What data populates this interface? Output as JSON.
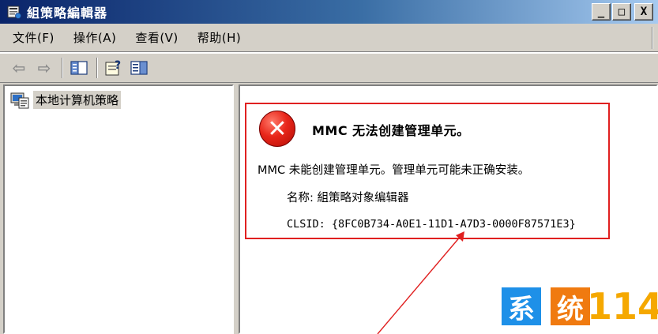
{
  "window": {
    "title": "組策略編輯器",
    "buttons": {
      "minimize": "_",
      "maximize": "□",
      "close": "X"
    }
  },
  "menu": {
    "items": [
      {
        "label": "文件(F)"
      },
      {
        "label": "操作(A)"
      },
      {
        "label": "查看(V)"
      },
      {
        "label": "帮助(H)"
      }
    ]
  },
  "toolbar": {
    "back": "⇦",
    "forward": "⇨"
  },
  "tree": {
    "root_label": "本地计算机策略"
  },
  "error": {
    "title": "MMC 无法创建管理单元。",
    "message": "MMC 未能创建管理单元。管理单元可能未正确安装。",
    "name_line": "名称: 組策略对象编辑器",
    "clsid_line": "CLSID: {8FC0B734-A0E1-11D1-A7D3-0000F87571E3}",
    "icon_glyph": "✕"
  },
  "watermark": {
    "char1": "系",
    "char2": "统",
    "number": "114"
  },
  "colors": {
    "titlebar_start": "#0a246a",
    "titlebar_end": "#a6caf0",
    "chrome": "#d4d0c8",
    "annotation": "#e02020",
    "watermark_blue": "#1e90e8",
    "watermark_orange": "#f07a10",
    "watermark_yellow": "#f5a800"
  }
}
